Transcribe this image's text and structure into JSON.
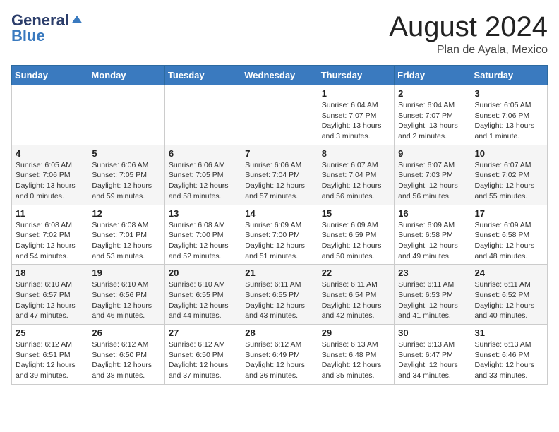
{
  "header": {
    "logo_general": "General",
    "logo_blue": "Blue",
    "month_title": "August 2024",
    "subtitle": "Plan de Ayala, Mexico"
  },
  "weekdays": [
    "Sunday",
    "Monday",
    "Tuesday",
    "Wednesday",
    "Thursday",
    "Friday",
    "Saturday"
  ],
  "weeks": [
    [
      {
        "day": "",
        "info": ""
      },
      {
        "day": "",
        "info": ""
      },
      {
        "day": "",
        "info": ""
      },
      {
        "day": "",
        "info": ""
      },
      {
        "day": "1",
        "info": "Sunrise: 6:04 AM\nSunset: 7:07 PM\nDaylight: 13 hours\nand 3 minutes."
      },
      {
        "day": "2",
        "info": "Sunrise: 6:04 AM\nSunset: 7:07 PM\nDaylight: 13 hours\nand 2 minutes."
      },
      {
        "day": "3",
        "info": "Sunrise: 6:05 AM\nSunset: 7:06 PM\nDaylight: 13 hours\nand 1 minute."
      }
    ],
    [
      {
        "day": "4",
        "info": "Sunrise: 6:05 AM\nSunset: 7:06 PM\nDaylight: 13 hours\nand 0 minutes."
      },
      {
        "day": "5",
        "info": "Sunrise: 6:06 AM\nSunset: 7:05 PM\nDaylight: 12 hours\nand 59 minutes."
      },
      {
        "day": "6",
        "info": "Sunrise: 6:06 AM\nSunset: 7:05 PM\nDaylight: 12 hours\nand 58 minutes."
      },
      {
        "day": "7",
        "info": "Sunrise: 6:06 AM\nSunset: 7:04 PM\nDaylight: 12 hours\nand 57 minutes."
      },
      {
        "day": "8",
        "info": "Sunrise: 6:07 AM\nSunset: 7:04 PM\nDaylight: 12 hours\nand 56 minutes."
      },
      {
        "day": "9",
        "info": "Sunrise: 6:07 AM\nSunset: 7:03 PM\nDaylight: 12 hours\nand 56 minutes."
      },
      {
        "day": "10",
        "info": "Sunrise: 6:07 AM\nSunset: 7:02 PM\nDaylight: 12 hours\nand 55 minutes."
      }
    ],
    [
      {
        "day": "11",
        "info": "Sunrise: 6:08 AM\nSunset: 7:02 PM\nDaylight: 12 hours\nand 54 minutes."
      },
      {
        "day": "12",
        "info": "Sunrise: 6:08 AM\nSunset: 7:01 PM\nDaylight: 12 hours\nand 53 minutes."
      },
      {
        "day": "13",
        "info": "Sunrise: 6:08 AM\nSunset: 7:00 PM\nDaylight: 12 hours\nand 52 minutes."
      },
      {
        "day": "14",
        "info": "Sunrise: 6:09 AM\nSunset: 7:00 PM\nDaylight: 12 hours\nand 51 minutes."
      },
      {
        "day": "15",
        "info": "Sunrise: 6:09 AM\nSunset: 6:59 PM\nDaylight: 12 hours\nand 50 minutes."
      },
      {
        "day": "16",
        "info": "Sunrise: 6:09 AM\nSunset: 6:58 PM\nDaylight: 12 hours\nand 49 minutes."
      },
      {
        "day": "17",
        "info": "Sunrise: 6:09 AM\nSunset: 6:58 PM\nDaylight: 12 hours\nand 48 minutes."
      }
    ],
    [
      {
        "day": "18",
        "info": "Sunrise: 6:10 AM\nSunset: 6:57 PM\nDaylight: 12 hours\nand 47 minutes."
      },
      {
        "day": "19",
        "info": "Sunrise: 6:10 AM\nSunset: 6:56 PM\nDaylight: 12 hours\nand 46 minutes."
      },
      {
        "day": "20",
        "info": "Sunrise: 6:10 AM\nSunset: 6:55 PM\nDaylight: 12 hours\nand 44 minutes."
      },
      {
        "day": "21",
        "info": "Sunrise: 6:11 AM\nSunset: 6:55 PM\nDaylight: 12 hours\nand 43 minutes."
      },
      {
        "day": "22",
        "info": "Sunrise: 6:11 AM\nSunset: 6:54 PM\nDaylight: 12 hours\nand 42 minutes."
      },
      {
        "day": "23",
        "info": "Sunrise: 6:11 AM\nSunset: 6:53 PM\nDaylight: 12 hours\nand 41 minutes."
      },
      {
        "day": "24",
        "info": "Sunrise: 6:11 AM\nSunset: 6:52 PM\nDaylight: 12 hours\nand 40 minutes."
      }
    ],
    [
      {
        "day": "25",
        "info": "Sunrise: 6:12 AM\nSunset: 6:51 PM\nDaylight: 12 hours\nand 39 minutes."
      },
      {
        "day": "26",
        "info": "Sunrise: 6:12 AM\nSunset: 6:50 PM\nDaylight: 12 hours\nand 38 minutes."
      },
      {
        "day": "27",
        "info": "Sunrise: 6:12 AM\nSunset: 6:50 PM\nDaylight: 12 hours\nand 37 minutes."
      },
      {
        "day": "28",
        "info": "Sunrise: 6:12 AM\nSunset: 6:49 PM\nDaylight: 12 hours\nand 36 minutes."
      },
      {
        "day": "29",
        "info": "Sunrise: 6:13 AM\nSunset: 6:48 PM\nDaylight: 12 hours\nand 35 minutes."
      },
      {
        "day": "30",
        "info": "Sunrise: 6:13 AM\nSunset: 6:47 PM\nDaylight: 12 hours\nand 34 minutes."
      },
      {
        "day": "31",
        "info": "Sunrise: 6:13 AM\nSunset: 6:46 PM\nDaylight: 12 hours\nand 33 minutes."
      }
    ]
  ]
}
